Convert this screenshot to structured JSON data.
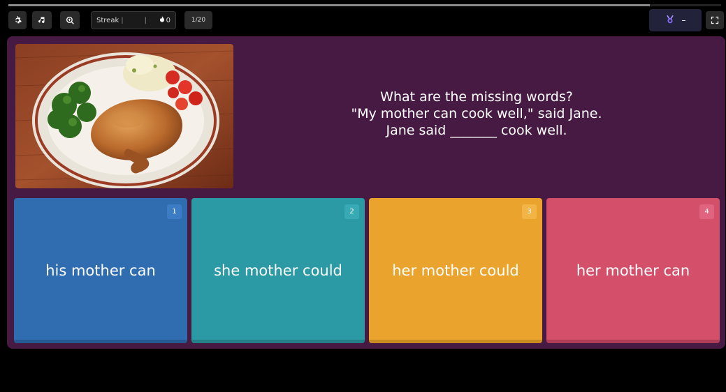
{
  "progress": {
    "fraction": 0.9
  },
  "toolbar": {
    "settings_icon": "gear-icon",
    "music_icon": "music-note-icon",
    "zoom_icon": "zoom-in-icon",
    "streak_label": "Streak",
    "streak_sep": "|",
    "streak_sep2": "|",
    "streak_count": "0",
    "question_counter": "1/20",
    "powerup_value": "–",
    "fullscreen_icon": "fullscreen-icon"
  },
  "question": {
    "lines": [
      "What are the missing words?",
      "\"My mother can cook well,\" said Jane.",
      "Jane said _______ cook well."
    ],
    "image_icon": "food-plate-image"
  },
  "options": [
    {
      "number": "1",
      "text": "his mother can",
      "color": "#2f6cb0",
      "num_bg": "#3b7cc4",
      "shadow": "#265a93"
    },
    {
      "number": "2",
      "text": "she mother could",
      "color": "#2b9aa5",
      "num_bg": "#37aab5",
      "shadow": "#237f88"
    },
    {
      "number": "3",
      "text": "her mother could",
      "color": "#eaa42e",
      "num_bg": "#f2b445",
      "shadow": "#c98a20"
    },
    {
      "number": "4",
      "text": "her mother can",
      "color": "#d34f6a",
      "num_bg": "#e06380",
      "shadow": "#b03d56"
    }
  ]
}
